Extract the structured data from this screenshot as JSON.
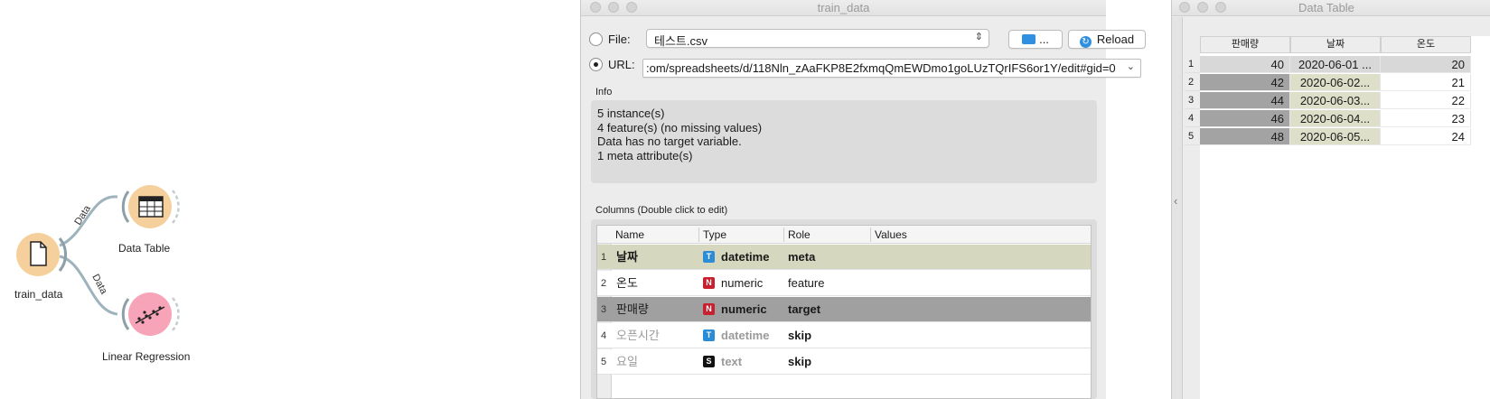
{
  "colors": {
    "file_node": "#f6d09c",
    "regression_node": "#f7a4b8",
    "meta_row": "#d6d7bf",
    "target_row": "#a0a0a0",
    "datetime_icon": "#2a8bd6",
    "numeric_icon": "#c8202e",
    "text_icon": "#111111"
  },
  "canvas": {
    "nodes": [
      {
        "label": "train_data",
        "icon": "file-icon"
      },
      {
        "label": "Data Table",
        "icon": "table-icon"
      },
      {
        "label": "Linear Regression",
        "icon": "regression-icon"
      }
    ],
    "links": [
      {
        "label": "Data"
      },
      {
        "label": "Data"
      }
    ]
  },
  "file_window": {
    "title": "train_data",
    "file_label": "File:",
    "file_value": "테스트.csv",
    "browse_label": "...",
    "reload_label": "Reload",
    "url_label": "URL:",
    "url_value": ":om/spreadsheets/d/118Nln_zAaFKP8E2fxmqQmEWDmo1goLUzTQrIFS6or1Y/edit#gid=0",
    "info_title": "Info",
    "info_lines": [
      "5 instance(s)",
      "4 feature(s) (no missing values)",
      "Data has no target variable.",
      "1 meta attribute(s)"
    ],
    "columns_title": "Columns (Double click to edit)",
    "columns_headers": [
      "Name",
      "Type",
      "Role",
      "Values"
    ],
    "columns": [
      {
        "num": "1",
        "name": "날짜",
        "type_icon": "T",
        "type": "datetime",
        "role": "meta",
        "style": "meta"
      },
      {
        "num": "2",
        "name": "온도",
        "type_icon": "N",
        "type": "numeric",
        "role": "feature",
        "style": "normal"
      },
      {
        "num": "3",
        "name": "판매량",
        "type_icon": "N",
        "type": "numeric",
        "role": "target",
        "style": "target"
      },
      {
        "num": "4",
        "name": "오픈시간",
        "type_icon": "T",
        "type": "datetime",
        "role": "skip",
        "style": "skip"
      },
      {
        "num": "5",
        "name": "요일",
        "type_icon": "S",
        "type": "text",
        "role": "skip",
        "style": "skip"
      }
    ]
  },
  "data_table_window": {
    "title": "Data Table",
    "headers": [
      "판매량",
      "날짜",
      "온도"
    ],
    "rows": [
      {
        "num": "1",
        "sales": "40",
        "date": "2020-06-01 ...",
        "temp": "20"
      },
      {
        "num": "2",
        "sales": "42",
        "date": "2020-06-02...",
        "temp": "21"
      },
      {
        "num": "3",
        "sales": "44",
        "date": "2020-06-03...",
        "temp": "22"
      },
      {
        "num": "4",
        "sales": "46",
        "date": "2020-06-04...",
        "temp": "23"
      },
      {
        "num": "5",
        "sales": "48",
        "date": "2020-06-05...",
        "temp": "24"
      }
    ],
    "collapse_arrow": "‹"
  }
}
